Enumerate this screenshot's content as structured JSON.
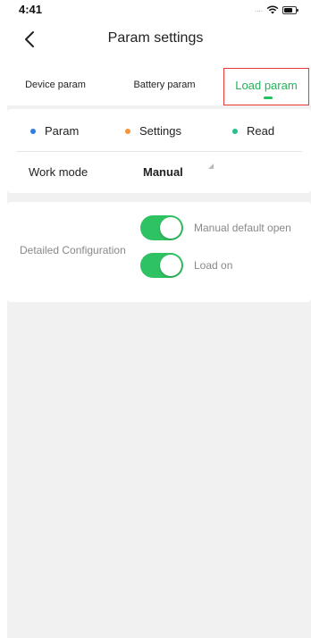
{
  "status_bar": {
    "time": "4:41",
    "signal": "....",
    "wifi_icon": "wifi-icon",
    "battery_icon": "battery-icon"
  },
  "nav": {
    "back_icon": "chevron-left-icon",
    "title": "Param settings"
  },
  "tabs": [
    {
      "label": "Device param",
      "active": false
    },
    {
      "label": "Battery param",
      "active": false
    },
    {
      "label": "Load param",
      "active": true
    }
  ],
  "legend": [
    {
      "label": "Param",
      "color": "#2f7de1"
    },
    {
      "label": "Settings",
      "color": "#f5963a"
    },
    {
      "label": "Read",
      "color": "#22c28a"
    }
  ],
  "work_mode": {
    "label": "Work mode",
    "value": "Manual"
  },
  "detailed_config": {
    "label": "Detailed Configuration",
    "toggles": [
      {
        "label": "Manual default open",
        "on": true
      },
      {
        "label": "Load on",
        "on": true
      }
    ]
  },
  "colors": {
    "accent_green": "#22b45a",
    "toggle_on": "#2fc262",
    "highlight_border": "#e53935",
    "background": "#f1f1f2"
  }
}
